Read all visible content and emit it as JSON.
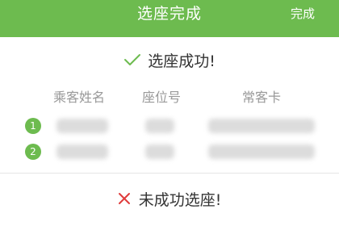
{
  "header": {
    "title": "选座完成",
    "done_label": "完成",
    "accent_color": "#6dbb4f"
  },
  "success": {
    "icon": "check-icon",
    "text": "选座成功!"
  },
  "table": {
    "columns": [
      "乘客姓名",
      "座位号",
      "常客卡"
    ],
    "rows": [
      {
        "index": "1"
      },
      {
        "index": "2"
      }
    ]
  },
  "failure": {
    "icon": "close-icon",
    "text": "未成功选座!",
    "icon_color": "#e03c3c"
  }
}
